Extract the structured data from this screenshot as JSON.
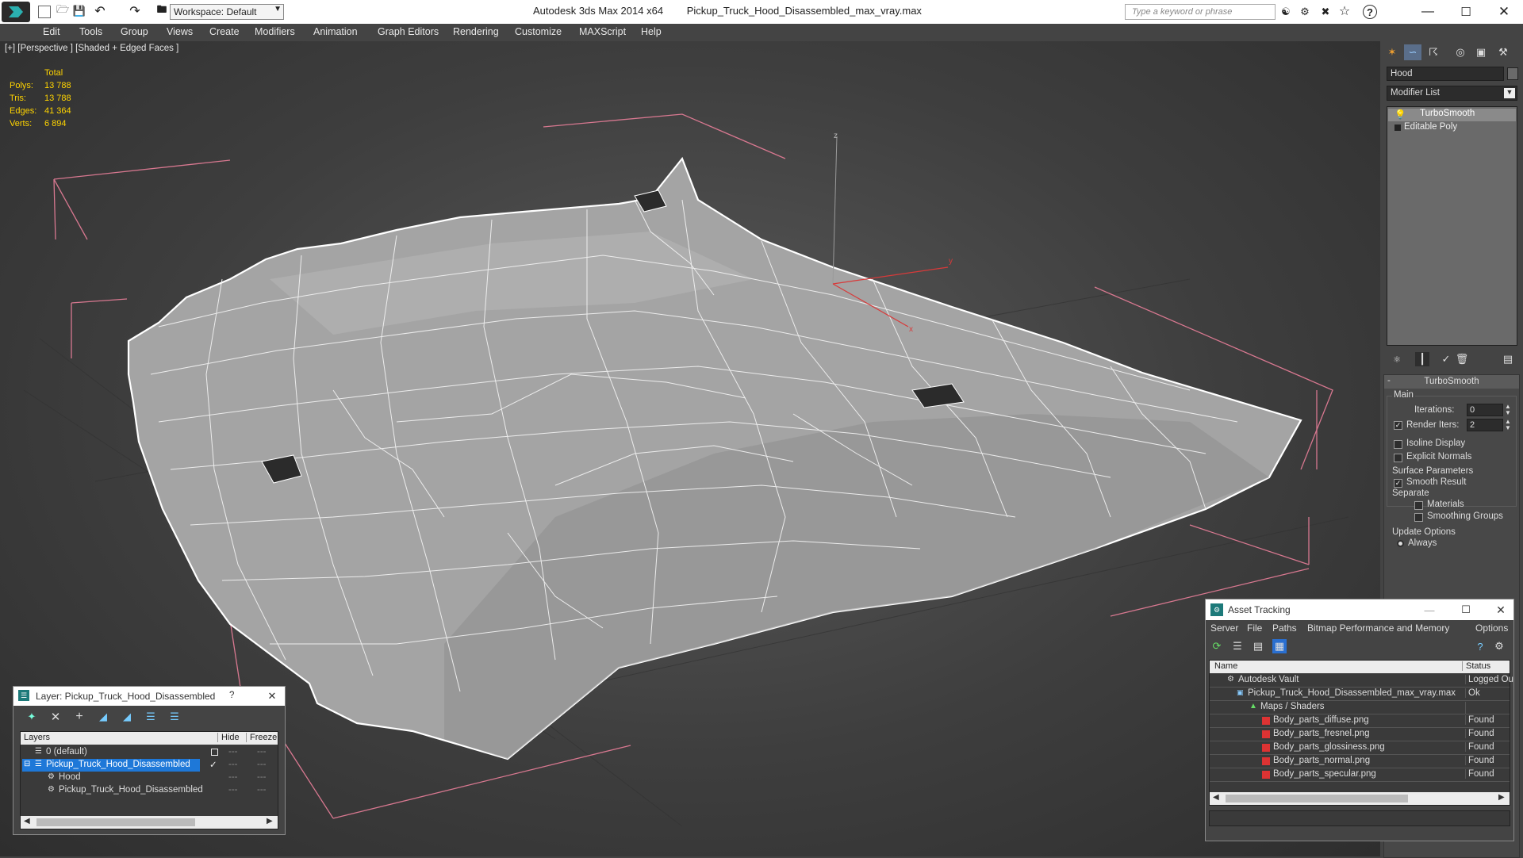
{
  "titlebar": {
    "app_title": "Autodesk 3ds Max  2014 x64",
    "file_title": "Pickup_Truck_Hood_Disassembled_max_vray.max",
    "workspace": "Workspace: Default",
    "search_placeholder": "Type a keyword or phrase"
  },
  "menu": [
    "Edit",
    "Tools",
    "Group",
    "Views",
    "Create",
    "Modifiers",
    "Animation",
    "Graph Editors",
    "Rendering",
    "Customize",
    "MAXScript",
    "Help"
  ],
  "viewport": {
    "label": "[+] [Perspective ] [Shaded + Edged Faces ]",
    "stats": {
      "header": "Total",
      "rows": [
        {
          "k": "Polys:",
          "v": "13 788"
        },
        {
          "k": "Tris:",
          "v": "13 788"
        },
        {
          "k": "Edges:",
          "v": "41 364"
        },
        {
          "k": "Verts:",
          "v": "6 894"
        }
      ]
    },
    "axes": {
      "x": "x",
      "y": "y",
      "z": "z"
    }
  },
  "command_panel": {
    "object_name": "Hood",
    "modifier_list": "Modifier List",
    "stack": [
      "TurboSmooth",
      "Editable Poly"
    ],
    "rollout_title": "TurboSmooth",
    "main_group": "Main",
    "iterations_label": "Iterations:",
    "iterations_value": "0",
    "render_iters_label": "Render Iters:",
    "render_iters_value": "2",
    "isoline": "Isoline Display",
    "explicit_normals": "Explicit Normals",
    "surface_group": "Surface Parameters",
    "smooth_result": "Smooth Result",
    "separate": "Separate",
    "materials": "Materials",
    "smoothing_groups": "Smoothing Groups",
    "update_group": "Update Options",
    "always": "Always",
    "colors": {
      "accent": "#3d7dd6",
      "bg": "#444444"
    }
  },
  "layer_window": {
    "title": "Layer: Pickup_Truck_Hood_Disassembled",
    "help": "?",
    "columns": [
      "Layers",
      "Hide",
      "Freeze"
    ],
    "rows": [
      {
        "name": "0 (default)",
        "indent": 1,
        "selected": false
      },
      {
        "name": "Pickup_Truck_Hood_Disassembled",
        "indent": 1,
        "selected": true
      },
      {
        "name": "Hood",
        "indent": 2,
        "selected": false
      },
      {
        "name": "Pickup_Truck_Hood_Disassembled",
        "indent": 2,
        "selected": false
      }
    ]
  },
  "asset_window": {
    "title": "Asset Tracking",
    "menu": [
      "Server",
      "File",
      "Paths",
      "Bitmap Performance and Memory",
      "Options"
    ],
    "columns": [
      "Name",
      "Status"
    ],
    "rows": [
      {
        "name": "Autodesk Vault",
        "status": "Logged Ou",
        "indent": 1
      },
      {
        "name": "Pickup_Truck_Hood_Disassembled_max_vray.max",
        "status": "Ok",
        "indent": 2
      },
      {
        "name": "Maps / Shaders",
        "status": "",
        "indent": 3
      },
      {
        "name": "Body_parts_diffuse.png",
        "status": "Found",
        "indent": 4
      },
      {
        "name": "Body_parts_fresnel.png",
        "status": "Found",
        "indent": 4
      },
      {
        "name": "Body_parts_glossiness.png",
        "status": "Found",
        "indent": 4
      },
      {
        "name": "Body_parts_normal.png",
        "status": "Found",
        "indent": 4
      },
      {
        "name": "Body_parts_specular.png",
        "status": "Found",
        "indent": 4
      }
    ]
  }
}
